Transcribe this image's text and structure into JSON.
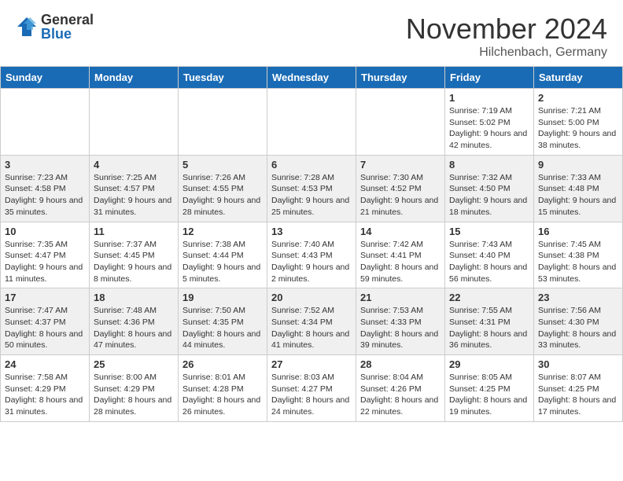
{
  "header": {
    "logo": {
      "general": "General",
      "blue": "Blue"
    },
    "title": "November 2024",
    "location": "Hilchenbach, Germany"
  },
  "weekdays": [
    "Sunday",
    "Monday",
    "Tuesday",
    "Wednesday",
    "Thursday",
    "Friday",
    "Saturday"
  ],
  "weeks": [
    {
      "row_class": "row-1",
      "days": [
        {
          "num": "",
          "info": "",
          "empty": true
        },
        {
          "num": "",
          "info": "",
          "empty": true
        },
        {
          "num": "",
          "info": "",
          "empty": true
        },
        {
          "num": "",
          "info": "",
          "empty": true
        },
        {
          "num": "",
          "info": "",
          "empty": true
        },
        {
          "num": "1",
          "info": "Sunrise: 7:19 AM\nSunset: 5:02 PM\nDaylight: 9 hours and 42 minutes."
        },
        {
          "num": "2",
          "info": "Sunrise: 7:21 AM\nSunset: 5:00 PM\nDaylight: 9 hours and 38 minutes."
        }
      ]
    },
    {
      "row_class": "row-2",
      "days": [
        {
          "num": "3",
          "info": "Sunrise: 7:23 AM\nSunset: 4:58 PM\nDaylight: 9 hours and 35 minutes."
        },
        {
          "num": "4",
          "info": "Sunrise: 7:25 AM\nSunset: 4:57 PM\nDaylight: 9 hours and 31 minutes."
        },
        {
          "num": "5",
          "info": "Sunrise: 7:26 AM\nSunset: 4:55 PM\nDaylight: 9 hours and 28 minutes."
        },
        {
          "num": "6",
          "info": "Sunrise: 7:28 AM\nSunset: 4:53 PM\nDaylight: 9 hours and 25 minutes."
        },
        {
          "num": "7",
          "info": "Sunrise: 7:30 AM\nSunset: 4:52 PM\nDaylight: 9 hours and 21 minutes."
        },
        {
          "num": "8",
          "info": "Sunrise: 7:32 AM\nSunset: 4:50 PM\nDaylight: 9 hours and 18 minutes."
        },
        {
          "num": "9",
          "info": "Sunrise: 7:33 AM\nSunset: 4:48 PM\nDaylight: 9 hours and 15 minutes."
        }
      ]
    },
    {
      "row_class": "row-3",
      "days": [
        {
          "num": "10",
          "info": "Sunrise: 7:35 AM\nSunset: 4:47 PM\nDaylight: 9 hours and 11 minutes."
        },
        {
          "num": "11",
          "info": "Sunrise: 7:37 AM\nSunset: 4:45 PM\nDaylight: 9 hours and 8 minutes."
        },
        {
          "num": "12",
          "info": "Sunrise: 7:38 AM\nSunset: 4:44 PM\nDaylight: 9 hours and 5 minutes."
        },
        {
          "num": "13",
          "info": "Sunrise: 7:40 AM\nSunset: 4:43 PM\nDaylight: 9 hours and 2 minutes."
        },
        {
          "num": "14",
          "info": "Sunrise: 7:42 AM\nSunset: 4:41 PM\nDaylight: 8 hours and 59 minutes."
        },
        {
          "num": "15",
          "info": "Sunrise: 7:43 AM\nSunset: 4:40 PM\nDaylight: 8 hours and 56 minutes."
        },
        {
          "num": "16",
          "info": "Sunrise: 7:45 AM\nSunset: 4:38 PM\nDaylight: 8 hours and 53 minutes."
        }
      ]
    },
    {
      "row_class": "row-4",
      "days": [
        {
          "num": "17",
          "info": "Sunrise: 7:47 AM\nSunset: 4:37 PM\nDaylight: 8 hours and 50 minutes."
        },
        {
          "num": "18",
          "info": "Sunrise: 7:48 AM\nSunset: 4:36 PM\nDaylight: 8 hours and 47 minutes."
        },
        {
          "num": "19",
          "info": "Sunrise: 7:50 AM\nSunset: 4:35 PM\nDaylight: 8 hours and 44 minutes."
        },
        {
          "num": "20",
          "info": "Sunrise: 7:52 AM\nSunset: 4:34 PM\nDaylight: 8 hours and 41 minutes."
        },
        {
          "num": "21",
          "info": "Sunrise: 7:53 AM\nSunset: 4:33 PM\nDaylight: 8 hours and 39 minutes."
        },
        {
          "num": "22",
          "info": "Sunrise: 7:55 AM\nSunset: 4:31 PM\nDaylight: 8 hours and 36 minutes."
        },
        {
          "num": "23",
          "info": "Sunrise: 7:56 AM\nSunset: 4:30 PM\nDaylight: 8 hours and 33 minutes."
        }
      ]
    },
    {
      "row_class": "row-5",
      "days": [
        {
          "num": "24",
          "info": "Sunrise: 7:58 AM\nSunset: 4:29 PM\nDaylight: 8 hours and 31 minutes."
        },
        {
          "num": "25",
          "info": "Sunrise: 8:00 AM\nSunset: 4:29 PM\nDaylight: 8 hours and 28 minutes."
        },
        {
          "num": "26",
          "info": "Sunrise: 8:01 AM\nSunset: 4:28 PM\nDaylight: 8 hours and 26 minutes."
        },
        {
          "num": "27",
          "info": "Sunrise: 8:03 AM\nSunset: 4:27 PM\nDaylight: 8 hours and 24 minutes."
        },
        {
          "num": "28",
          "info": "Sunrise: 8:04 AM\nSunset: 4:26 PM\nDaylight: 8 hours and 22 minutes."
        },
        {
          "num": "29",
          "info": "Sunrise: 8:05 AM\nSunset: 4:25 PM\nDaylight: 8 hours and 19 minutes."
        },
        {
          "num": "30",
          "info": "Sunrise: 8:07 AM\nSunset: 4:25 PM\nDaylight: 8 hours and 17 minutes."
        }
      ]
    }
  ]
}
